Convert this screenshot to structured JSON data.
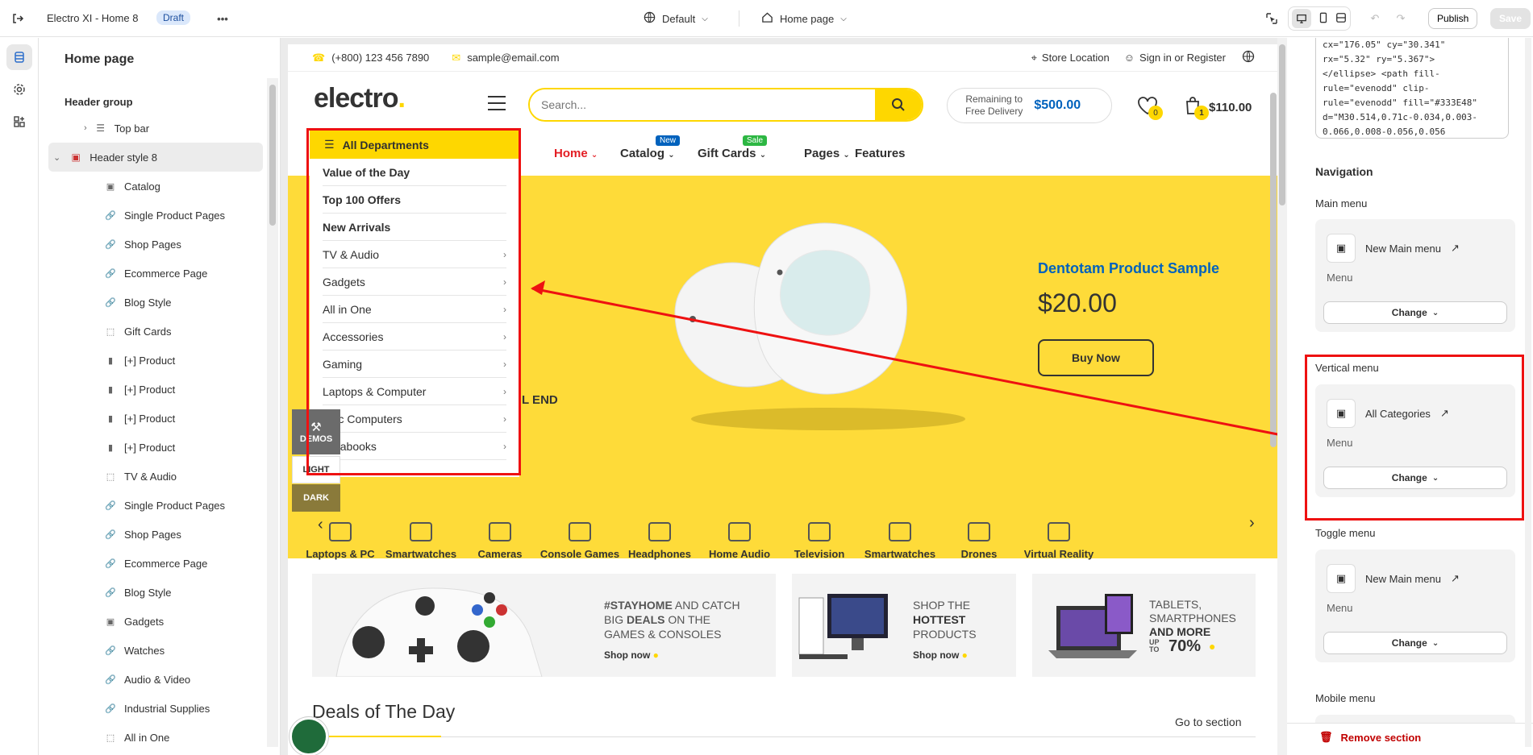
{
  "topbar": {
    "app_title": "Electro XI - Home 8",
    "status_badge": "Draft",
    "theme_selector": "Default",
    "page_selector": "Home page",
    "publish_label": "Publish",
    "save_label": "Save"
  },
  "left_panel": {
    "title": "Home page",
    "group_label": "Header group",
    "items": [
      {
        "label": "Top bar",
        "icon": "layout-icon"
      },
      {
        "label": "Header style 8",
        "icon": "image-icon"
      },
      {
        "label": "Catalog",
        "icon": "image-icon"
      },
      {
        "label": "Single Product Pages",
        "icon": "link-icon"
      },
      {
        "label": "Shop Pages",
        "icon": "link-icon"
      },
      {
        "label": "Ecommerce Page",
        "icon": "link-icon"
      },
      {
        "label": "Blog Style",
        "icon": "link-icon"
      },
      {
        "label": "Gift Cards",
        "icon": "dashed-frame-icon"
      },
      {
        "label": "[+] Product",
        "icon": "product-thumb-icon"
      },
      {
        "label": "[+] Product",
        "icon": "product-thumb-icon"
      },
      {
        "label": "[+] Product",
        "icon": "product-thumb-icon"
      },
      {
        "label": "[+] Product",
        "icon": "product-thumb-icon"
      },
      {
        "label": "TV & Audio",
        "icon": "dashed-frame-icon"
      },
      {
        "label": "Single Product Pages",
        "icon": "link-icon"
      },
      {
        "label": "Shop Pages",
        "icon": "link-icon"
      },
      {
        "label": "Ecommerce Page",
        "icon": "link-icon"
      },
      {
        "label": "Blog Style",
        "icon": "link-icon"
      },
      {
        "label": "Gadgets",
        "icon": "image-icon"
      },
      {
        "label": "Watches",
        "icon": "link-icon"
      },
      {
        "label": "Audio & Video",
        "icon": "link-icon"
      },
      {
        "label": "Industrial Supplies",
        "icon": "link-icon"
      },
      {
        "label": "All in One",
        "icon": "dashed-frame-icon"
      }
    ]
  },
  "site": {
    "phone": "(+800) 123 456 7890",
    "email": "sample@email.com",
    "store_location": "Store Location",
    "sign_in": "Sign in or Register",
    "logo_text": "electro",
    "search_placeholder": "Search...",
    "delivery_line1": "Remaining to",
    "delivery_line2": "Free Delivery",
    "delivery_amount": "$500.00",
    "wishlist_count": "0",
    "cart_count": "1",
    "cart_total": "$110.00",
    "nav": {
      "home": "Home",
      "catalog": "Catalog",
      "catalog_tag": "New",
      "gift_cards": "Gift Cards",
      "gift_tag": "Sale",
      "pages": "Pages",
      "features": "Features"
    },
    "departments": {
      "title": "All Departments",
      "bold_items": [
        "Value of the Day",
        "Top 100 Offers",
        "New Arrivals"
      ],
      "sub_items": [
        "TV & Audio",
        "Gadgets",
        "All in One",
        "Accessories",
        "Gaming",
        "Laptops & Computer",
        "Mac Computers",
        "Ultrabooks"
      ]
    },
    "hero": {
      "product_title": "Dentotam Product Sample",
      "price": "$20.00",
      "cta": "Buy Now",
      "partial_text": "L END"
    },
    "float_buttons": {
      "demos": "DEMOS",
      "light": "LIGHT",
      "dark": "DARK"
    },
    "categories": [
      "Laptops & PC",
      "Smartwatches",
      "Cameras",
      "Console Games",
      "Headphones",
      "Home Audio",
      "Television",
      "Smartwatches",
      "Drones",
      "Virtual Reality"
    ],
    "promos": [
      {
        "pre": "#STAYHOME",
        "text": " AND CATCH BIG ",
        "bold": "DEALS",
        "text2": " ON THE GAMES & CONSOLES",
        "shop": "Shop now"
      },
      {
        "pre": "SHOP THE",
        "bold": "HOTTEST",
        "text2": "PRODUCTS",
        "shop": "Shop now"
      },
      {
        "pre": "TABLETS, SMARTPHONES",
        "bold": "AND MORE",
        "text2": "70%",
        "upto": "UP TO"
      }
    ],
    "deals_title": "Deals of The Day",
    "goto_section": "Go to section"
  },
  "right_panel": {
    "code_snippet": "cx=\"176.05\" cy=\"30.341\"\nrx=\"5.32\" ry=\"5.367\">\n</ellipse> <path fill-\nrule=\"evenodd\" clip-\nrule=\"evenodd\" fill=\"#333E48\"\nd=\"M30.514,0.71c-0.034,0.003-\n0.066,0.008-0.056,0.056",
    "navigation_title": "Navigation",
    "main_menu": {
      "label": "Main menu",
      "entry": "New Main menu",
      "sub": "Menu",
      "change": "Change"
    },
    "vertical_menu": {
      "label": "Vertical menu",
      "entry": "All Categories",
      "sub": "Menu",
      "change": "Change"
    },
    "toggle_menu": {
      "label": "Toggle menu",
      "entry": "New Main menu",
      "sub": "Menu",
      "change": "Change"
    },
    "mobile_menu": {
      "label": "Mobile menu"
    },
    "remove_section": "Remove section"
  },
  "colors": {
    "accent_yellow": "#fed700",
    "hero_yellow": "#fedb39",
    "link_blue": "#0062bd",
    "annotation_red": "#e11111"
  }
}
